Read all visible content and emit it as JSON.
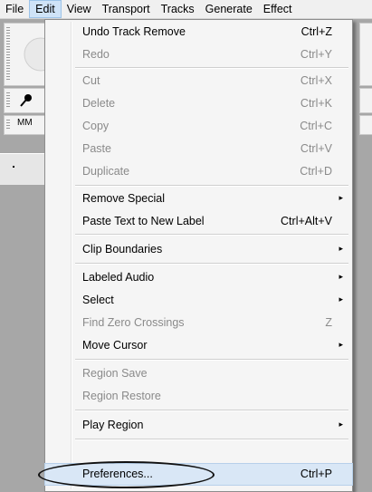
{
  "menubar": {
    "items": [
      "File",
      "Edit",
      "View",
      "Transport",
      "Tracks",
      "Generate",
      "Effect"
    ]
  },
  "toolbar": {
    "meter_label": "MM"
  },
  "edit_menu": {
    "items": [
      {
        "label": "Undo Track Remove",
        "shortcut": "Ctrl+Z"
      },
      {
        "label": "Redo",
        "shortcut": "Ctrl+Y"
      },
      {
        "label": "Cut",
        "shortcut": "Ctrl+X"
      },
      {
        "label": "Delete",
        "shortcut": "Ctrl+K"
      },
      {
        "label": "Copy",
        "shortcut": "Ctrl+C"
      },
      {
        "label": "Paste",
        "shortcut": "Ctrl+V"
      },
      {
        "label": "Duplicate",
        "shortcut": "Ctrl+D"
      },
      {
        "label": "Remove Special",
        "arrow": "▸"
      },
      {
        "label": "Paste Text to New Label",
        "shortcut": "Ctrl+Alt+V"
      },
      {
        "label": "Clip Boundaries",
        "arrow": "▸"
      },
      {
        "label": "Labeled Audio",
        "arrow": "▸"
      },
      {
        "label": "Select",
        "arrow": "▸"
      },
      {
        "label": "Find Zero Crossings",
        "shortcut": "Z"
      },
      {
        "label": "Move Cursor",
        "arrow": "▸"
      },
      {
        "label": "Region Save"
      },
      {
        "label": "Region Restore"
      },
      {
        "label": "Play Region",
        "arrow": "▸"
      },
      {
        "label": "Preferences...",
        "shortcut": "Ctrl+P"
      }
    ]
  }
}
